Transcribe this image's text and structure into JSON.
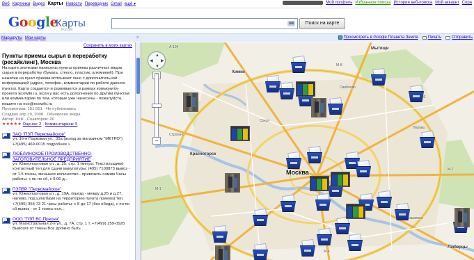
{
  "gbar": {
    "links": [
      "Веб",
      "Картинки",
      "Видео",
      "Карты",
      "Новости",
      "Переводчик",
      "Gmail",
      "ещё ▾"
    ],
    "current": "Карты",
    "right": [
      "Мой профиль",
      "Избранное поиска",
      "История веб-поиска",
      "Мой аккаунт",
      "Спра"
    ]
  },
  "header": {
    "logo": "Google",
    "product": "Карты",
    "region": "Россия",
    "search_value": "",
    "search_button": "Поиск на карте"
  },
  "bar2": {
    "routes": "Маршруты",
    "my_maps": "Мои карты",
    "collapse": "«",
    "earth": "Просмотреть в Google Планета Земля",
    "print": "Печать",
    "send": "Отправить"
  },
  "panel": {
    "save_link": "Сохранить в моих картах",
    "title": "Пункты приемы сырья в переработку (ресайклинг), Москва",
    "description": "На карте значками нанесены пункты приемы различных видов сырья в переработку (бумага, стекло, пластик, алюминий). При нажатии на пункт приема всплывает окно с дополнительной информацией (адрес, телефон, комментарии по работе данного пункта). Карта создается и развивается в рамках комьюнити-проекта Ecowiki.ru. Если у вас есть дополнения по другим пунктам или комментарии по тем, которые уже нанесены - пожалуйста, пишите на eco@ecowiki.ru",
    "views": "Просмотров: 151 551 · Не публиковать",
    "created": "Создано апр 29, 2008 · Обновлено вчера",
    "author": "Автор: Kirill · Соавторов: 20",
    "stars": "★★★★★",
    "rating": "Оценок: 2",
    "comments": "Комментариев: 5",
    "listings": [
      {
        "title": "ЗАО \"ПЗП Первомайское\"",
        "text": "ул. 16-я Парковая ул., 35а (въезд за магазином \"МЕТРО\") +7(495) 469-0015 подробнее »"
      },
      {
        "title": "ЛЮБЛИНСКОЕ ПРОИЗВОДСТВЕННО-ЗАГОТОВИТЕЛЬНОЕ ПРЕДПРИЯТИЕ",
        "text": "ул. Южнопортовая ул., д. 25, стр. 1 (метро: Текстильщики) контактный тел для сдачи макулатуры: (495) 7100873 вывоз - от 1.5 тонны, меньшее количество - привозить самим Часы работы: с пн по сб, с 9.00 д..."
      },
      {
        "title": "ПЗПВР \"Первомайское\"",
        "text": "ул. Южнопортовая ул., д. 19А, (въезд - между д.25 и д.27, налево, под шлагбаум на территорию пункта приема) тел. +7(495) 354 73 21 часы работы: с 8 до 17 (без обеда), с пн по сб вывоз - от 1 тонны есл..."
      },
      {
        "title": "ООО \"ПЗП ВС Пресня\"",
        "text": "ул. Магистральная 2-я ул., д. 7А, стр. 1 т. +7(499) 259-0528 Вывозят от тонны Все должно быть"
      }
    ]
  },
  "map": {
    "places": {
      "mytishchi": "Мытищи",
      "khimki": "Химки",
      "krasnogorsk": "Красногорск",
      "moscow": "Москва",
      "lyubertsy": "Люберцы",
      "road_a104": "A-104",
      "road_m8": "M-8",
      "road_a103": "A-103",
      "road_m7": "M-7",
      "road_m1": "M-1",
      "road_m4": "M-4",
      "area_sviblovo": "Свиблово",
      "area_sokol": "Сокол",
      "area_perovo": "Перово",
      "area_kuzminki": "Кузьминки",
      "area_strogino": "Строгино"
    },
    "pan_up": "▲",
    "pan_down": "▼",
    "pan_left": "◀",
    "pan_right": "▶",
    "zoom_in": "+",
    "zoom_out": "−"
  }
}
